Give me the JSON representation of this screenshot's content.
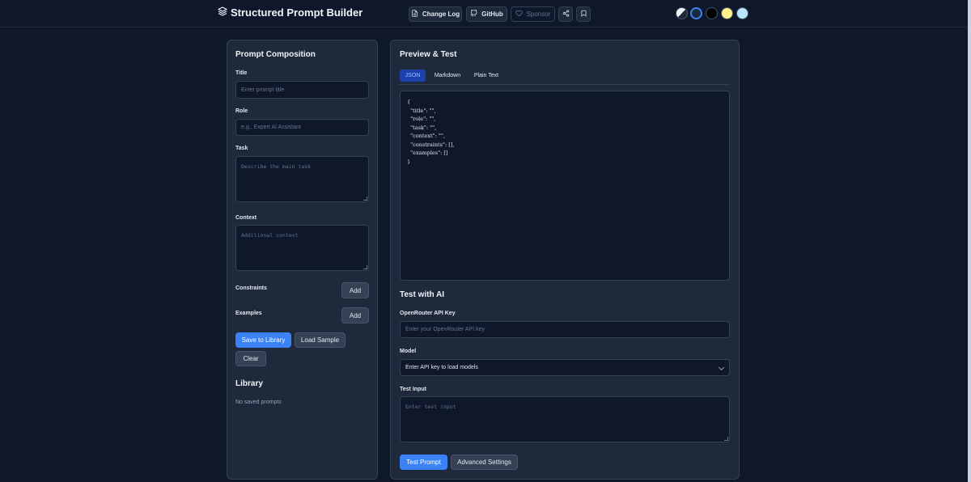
{
  "header": {
    "app_title": "Structured Prompt Builder",
    "buttons": {
      "change_log": "Change Log",
      "github": "GitHub",
      "sponsor": "Sponsor"
    },
    "theme_swatches": [
      {
        "name": "auto",
        "color": "#e2e8f0"
      },
      {
        "name": "dark-blue",
        "color": "#1e293b"
      },
      {
        "name": "black",
        "color": "#000000"
      },
      {
        "name": "yellow",
        "color": "#fef08a"
      },
      {
        "name": "light-blue",
        "color": "#bae6fd"
      }
    ]
  },
  "composition": {
    "title": "Prompt Composition",
    "title_label": "Title",
    "title_placeholder": "Enter prompt title",
    "role_label": "Role",
    "role_placeholder": "e.g., Expert AI Assistant",
    "task_label": "Task",
    "task_placeholder": "Describe the main task",
    "context_label": "Context",
    "context_placeholder": "Additional context",
    "constraints_label": "Constraints",
    "examples_label": "Examples",
    "add_label": "Add",
    "save_label": "Save to Library",
    "load_sample_label": "Load Sample",
    "clear_label": "Clear",
    "library_title": "Library",
    "library_empty": "No saved prompts"
  },
  "preview": {
    "title": "Preview & Test",
    "tabs": [
      "JSON",
      "Markdown",
      "Plain Text"
    ],
    "active_tab": "JSON",
    "code": "{\n  \"title\": \"\",\n  \"role\": \"\",\n  \"task\": \"\",\n  \"context\": \"\",\n  \"constraints\": [],\n  \"examples\": []\n}"
  },
  "test": {
    "title": "Test with AI",
    "api_key_label": "OpenRouter API Key",
    "api_key_placeholder": "Enter your OpenRouter API key",
    "model_label": "Model",
    "model_value": "Enter API key to load models",
    "input_label": "Test Input",
    "input_placeholder": "Enter test input",
    "test_button": "Test Prompt",
    "advanced_button": "Advanced Settings"
  },
  "colors": {
    "background": "#0f172a",
    "panel": "#1e293b",
    "accent": "#3b82f6"
  }
}
